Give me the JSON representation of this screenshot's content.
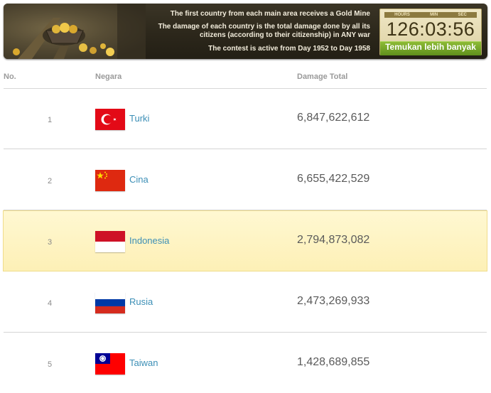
{
  "banner": {
    "line1": "The first country from each main area receives a Gold Mine",
    "line2": "The damage of each country is the total damage done by all its citizens (according to their citizenship) in ANY war",
    "line3": "The contest is active from Day 1952 to Day 1958",
    "image_icon": "gold-mine-cart-illustration"
  },
  "timer": {
    "hours_label": "HOURS",
    "min_label": "MIN",
    "sec_label": "SEC",
    "value": "126:03:56",
    "button_label": "Temukan lebih banyak"
  },
  "table": {
    "headers": {
      "rank": "No.",
      "country": "Negara",
      "damage": "Damage Total"
    },
    "rows": [
      {
        "rank": "1",
        "country": "Turki",
        "damage": "6,847,622,612",
        "flag": "turkey-flag",
        "highlighted": false
      },
      {
        "rank": "2",
        "country": "Cina",
        "damage": "6,655,422,529",
        "flag": "china-flag",
        "highlighted": false
      },
      {
        "rank": "3",
        "country": "Indonesia",
        "damage": "2,794,873,082",
        "flag": "indonesia-flag",
        "highlighted": true
      },
      {
        "rank": "4",
        "country": "Rusia",
        "damage": "2,473,269,933",
        "flag": "russia-flag",
        "highlighted": false
      },
      {
        "rank": "5",
        "country": "Taiwan",
        "damage": "1,428,689,855",
        "flag": "taiwan-flag",
        "highlighted": false
      }
    ]
  },
  "colors": {
    "banner_bg": "#2c271b",
    "link": "#3c8fb6",
    "highlight_row": "#fdf0b6",
    "button_green": "#6f9f24"
  }
}
